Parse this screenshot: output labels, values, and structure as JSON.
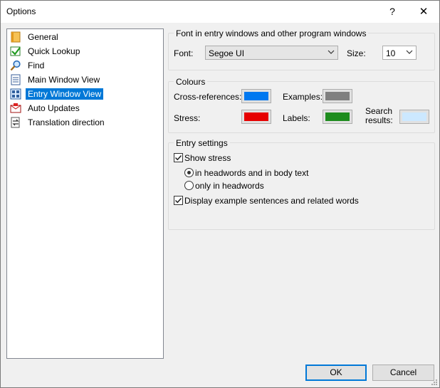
{
  "window": {
    "title": "Options",
    "help": "?",
    "close": "✕"
  },
  "tree": {
    "items": [
      {
        "label": "General",
        "icon": "general-icon",
        "selected": false
      },
      {
        "label": "Quick Lookup",
        "icon": "quick-lookup-icon",
        "selected": false
      },
      {
        "label": "Find",
        "icon": "find-icon",
        "selected": false
      },
      {
        "label": "Main Window View",
        "icon": "main-window-view-icon",
        "selected": false
      },
      {
        "label": "Entry Window View",
        "icon": "entry-window-view-icon",
        "selected": true
      },
      {
        "label": "Auto Updates",
        "icon": "auto-updates-icon",
        "selected": false
      },
      {
        "label": "Translation direction",
        "icon": "translation-direction-icon",
        "selected": false
      }
    ]
  },
  "font_group": {
    "legend": "Font in entry windows and other program windows",
    "font_label": "Font:",
    "font_value": "Segoe UI",
    "size_label": "Size:",
    "size_value": "10"
  },
  "colours_group": {
    "legend": "Colours",
    "cross_references_label": "Cross-references:",
    "cross_references_color": "#0078f0",
    "examples_label": "Examples:",
    "examples_color": "#7f7f7f",
    "stress_label": "Stress:",
    "stress_color": "#e60000",
    "labels_label": "Labels:",
    "labels_color": "#1e8c1e",
    "search_results_label_line1": "Search",
    "search_results_label_line2": "results:",
    "search_results_color": "#cce8ff"
  },
  "entry_group": {
    "legend": "Entry settings",
    "show_stress_label": "Show stress",
    "show_stress_checked": true,
    "radio_headwords_body_label": "in headwords and in body text",
    "radio_headwords_body_checked": true,
    "radio_headwords_only_label": "only in headwords",
    "radio_headwords_only_checked": false,
    "display_examples_label": "Display example sentences and related words",
    "display_examples_checked": true
  },
  "buttons": {
    "ok": "OK",
    "cancel": "Cancel"
  }
}
